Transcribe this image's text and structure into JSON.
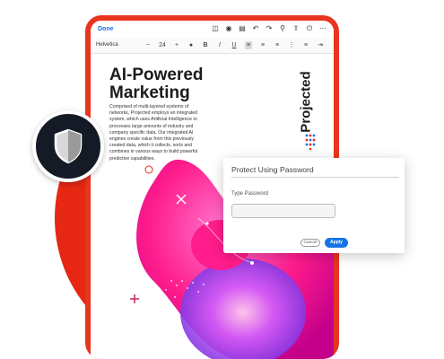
{
  "colors": {
    "accent_red": "#e52713",
    "tablet_frame": "#e8351f",
    "badge_dark": "#141a26",
    "primary_blue": "#1473e6"
  },
  "editor": {
    "done_label": "Done",
    "font_name": "Helvetica",
    "font_size": "24",
    "toolbar_icons": [
      "sidebar-icon",
      "eye-icon",
      "toggle-icon",
      "undo-icon",
      "redo-icon",
      "search-icon",
      "share-icon",
      "power-icon",
      "more-icon"
    ],
    "format_icons": [
      "font-size-icon",
      "color-icon",
      "bold-icon",
      "italic-icon",
      "underline-icon",
      "align-left-icon",
      "align-center-icon",
      "align-right-icon",
      "list-icon",
      "numbered-list-icon",
      "indent-icon"
    ]
  },
  "document": {
    "title": "AI-Powered Marketing",
    "body": "Comprised of multi-layered systems of networks, Projected employs an integrated system, which uses Artificial Intelligence to processes large amounts of industry and company specific data. Our integrated AI engines create value from this previously created data, which it collects, sorts and combines in various ways to build powerful predictive capabilities.",
    "side_brand": "Projected"
  },
  "dialog": {
    "title": "Protect Using Password",
    "label": "Type Password",
    "input_value": "",
    "cancel_label": "Cancel",
    "apply_label": "Apply"
  },
  "badge": {
    "icon": "shield-icon"
  }
}
